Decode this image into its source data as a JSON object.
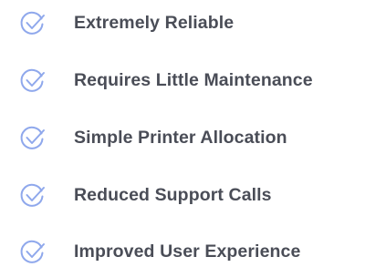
{
  "features": {
    "accent_color": "#8fa8ec",
    "text_color": "#4a4d57",
    "icon": "check-circle-icon",
    "items": [
      {
        "label": "Extremely Reliable"
      },
      {
        "label": "Requires Little Maintenance"
      },
      {
        "label": "Simple Printer Allocation"
      },
      {
        "label": "Reduced Support Calls"
      },
      {
        "label": "Improved User Experience"
      }
    ]
  }
}
